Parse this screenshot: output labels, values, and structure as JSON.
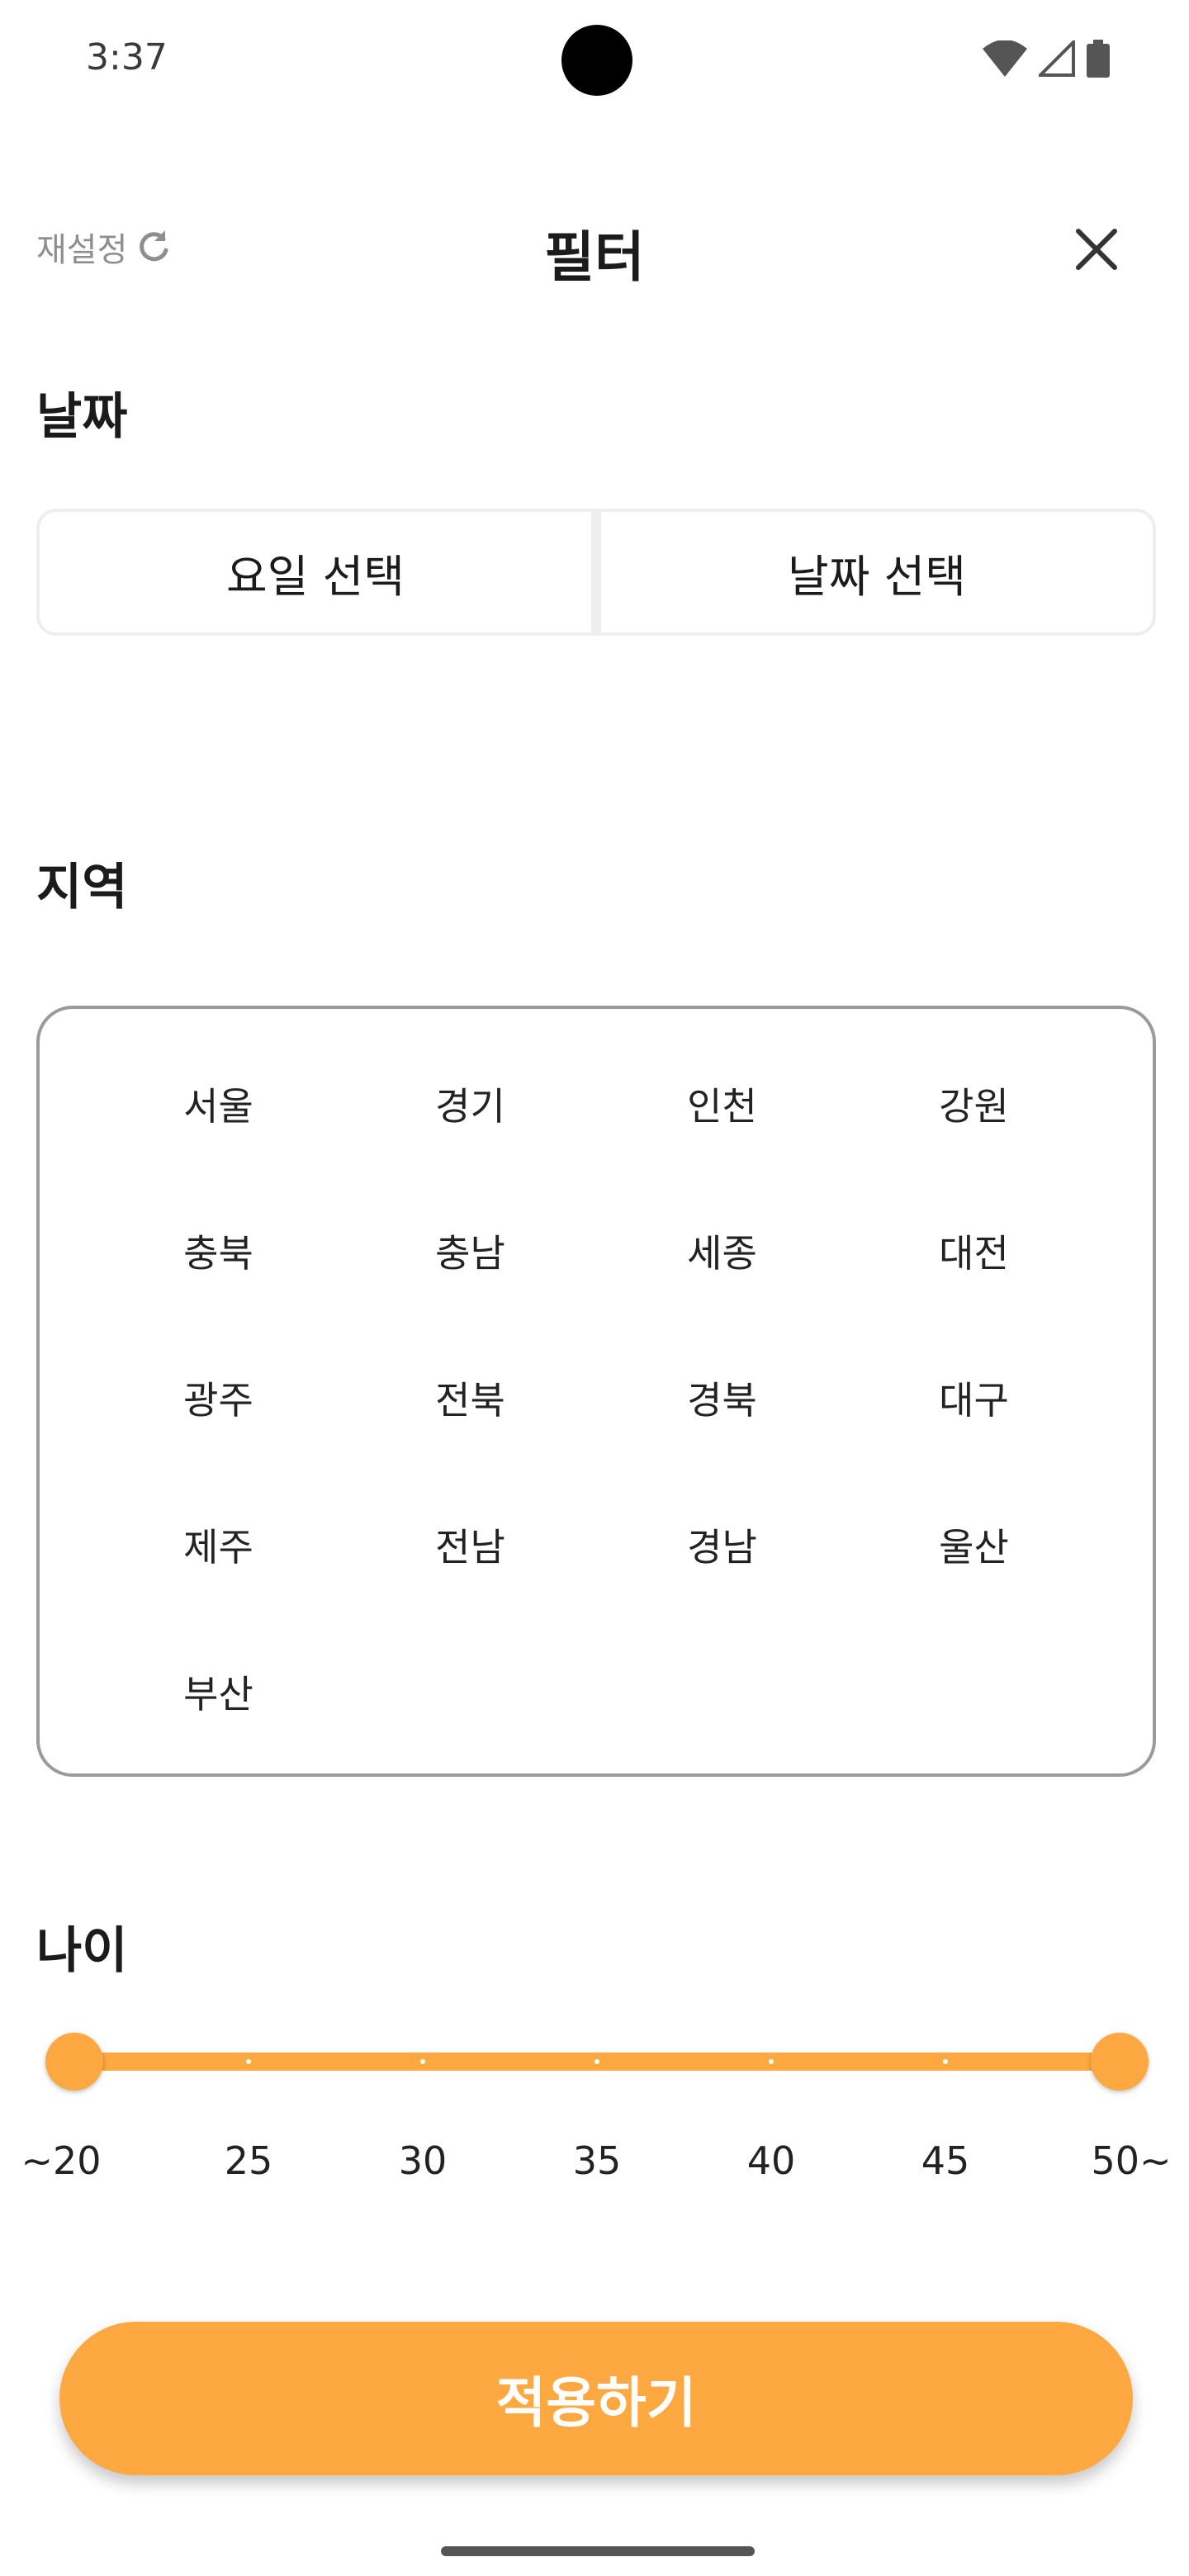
{
  "status_bar": {
    "time": "3:37"
  },
  "header": {
    "reset_label": "재설정",
    "title": "필터"
  },
  "date": {
    "label": "날짜",
    "options": [
      "요일 선택",
      "날짜 선택"
    ]
  },
  "region": {
    "label": "지역",
    "items": [
      "서울",
      "경기",
      "인천",
      "강원",
      "충북",
      "충남",
      "세종",
      "대전",
      "광주",
      "전북",
      "경북",
      "대구",
      "제주",
      "전남",
      "경남",
      "울산",
      "부산"
    ]
  },
  "age": {
    "label": "나이",
    "ticks": [
      "~20",
      "25",
      "30",
      "35",
      "40",
      "45",
      "50~"
    ],
    "range_min": "~20",
    "range_max": "50~"
  },
  "apply_label": "적용하기",
  "colors": {
    "accent": "#fda840",
    "border": "#9b9b9b",
    "muted": "#8e8e8e"
  }
}
